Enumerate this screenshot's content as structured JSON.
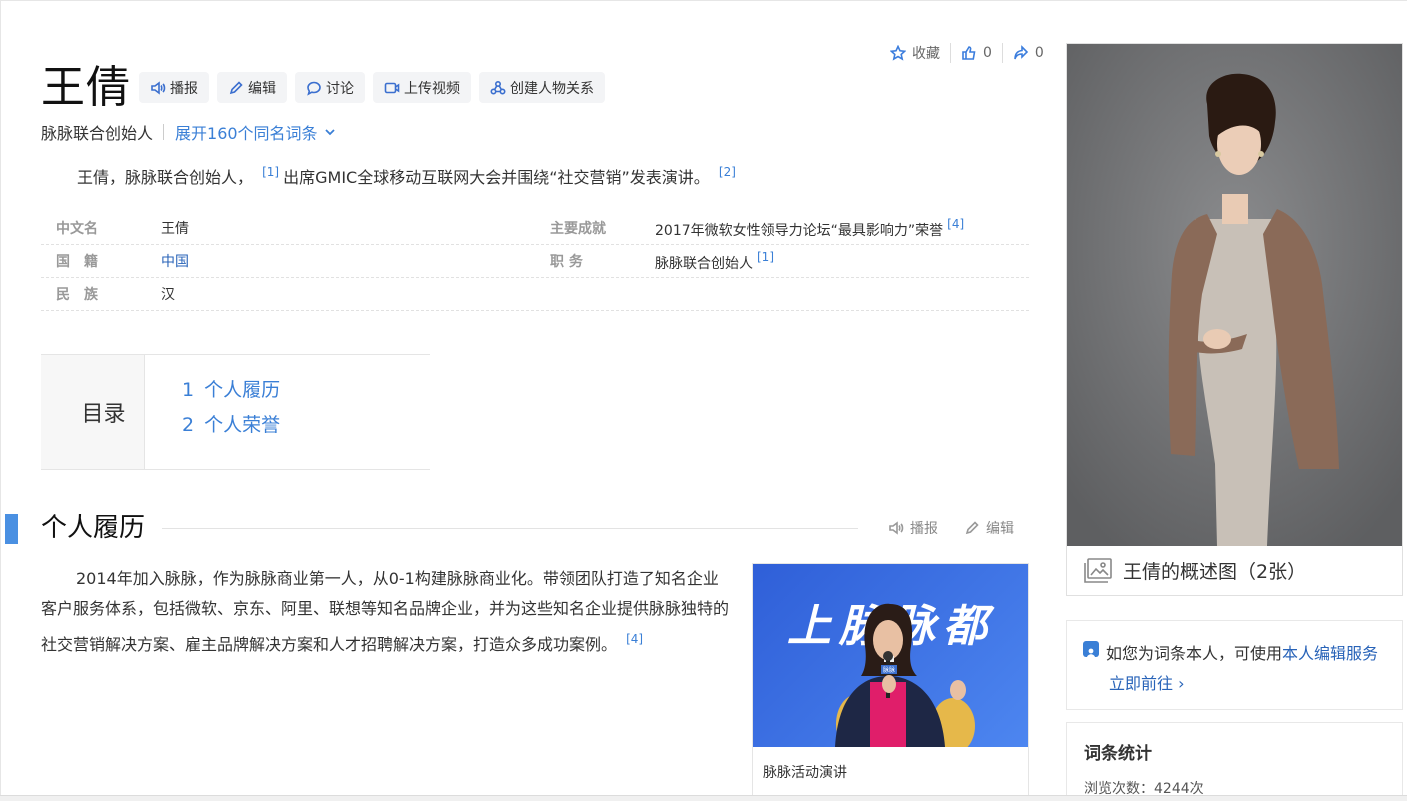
{
  "title": "王倩",
  "top_actions": {
    "favorite": "收藏",
    "likes": "0",
    "shares": "0"
  },
  "toolbar": {
    "broadcast": "播报",
    "edit": "编辑",
    "discuss": "讨论",
    "upload_video": "上传视频",
    "relations": "创建人物关系"
  },
  "subtitle": {
    "desc": "脉脉联合创始人",
    "expand": "展开160个同名词条"
  },
  "summary": {
    "part1": "王倩，脉脉联合创始人，",
    "ref1": "[1]",
    "part2": "出席GMIC全球移动互联网大会并围绕“社交营销”发表演讲。",
    "ref2": "[2]"
  },
  "infobox": {
    "rows": [
      {
        "n1": "中文名",
        "v1": "王倩",
        "n2": "主要成就",
        "v2": "2017年微软女性领导力论坛“最具影响力”荣誉",
        "r2": "[4]"
      },
      {
        "n1": "国　籍",
        "v1": "中国",
        "n2": "职 务",
        "v2": "脉脉联合创始人",
        "r2": "[1]"
      },
      {
        "n1": "民　族",
        "v1": "汉",
        "n2": "",
        "v2": "",
        "r2": ""
      }
    ]
  },
  "toc": {
    "head": "目录",
    "items": [
      {
        "num": "1",
        "label": "个人履历"
      },
      {
        "num": "2",
        "label": "个人荣誉"
      }
    ]
  },
  "section": {
    "title": "个人履历",
    "broadcast": "播报",
    "edit": "编辑",
    "body": "2014年加入脉脉，作为脉脉商业第一人，从0-1构建脉脉商业化。带领团队打造了知名企业客户服务体系，包括微软、京东、阿里、联想等知名品牌企业，并为这些知名企业提供脉脉独特的社交营销解决方案、雇主品牌解决方案和人才招聘解决方案，打造众多成功案例。",
    "ref": "[4]"
  },
  "figure": {
    "banner_text": "上脉脉都",
    "caption": "脉脉活动演讲",
    "badge": "脉脉"
  },
  "side": {
    "photo_caption": "王倩的概述图（2张）",
    "claim_text": "如您为词条本人，可使用",
    "claim_link": "本人编辑服务",
    "claim_go": "立即前往 ›",
    "stats_title": "词条统计",
    "views": "浏览次数：4244次"
  }
}
